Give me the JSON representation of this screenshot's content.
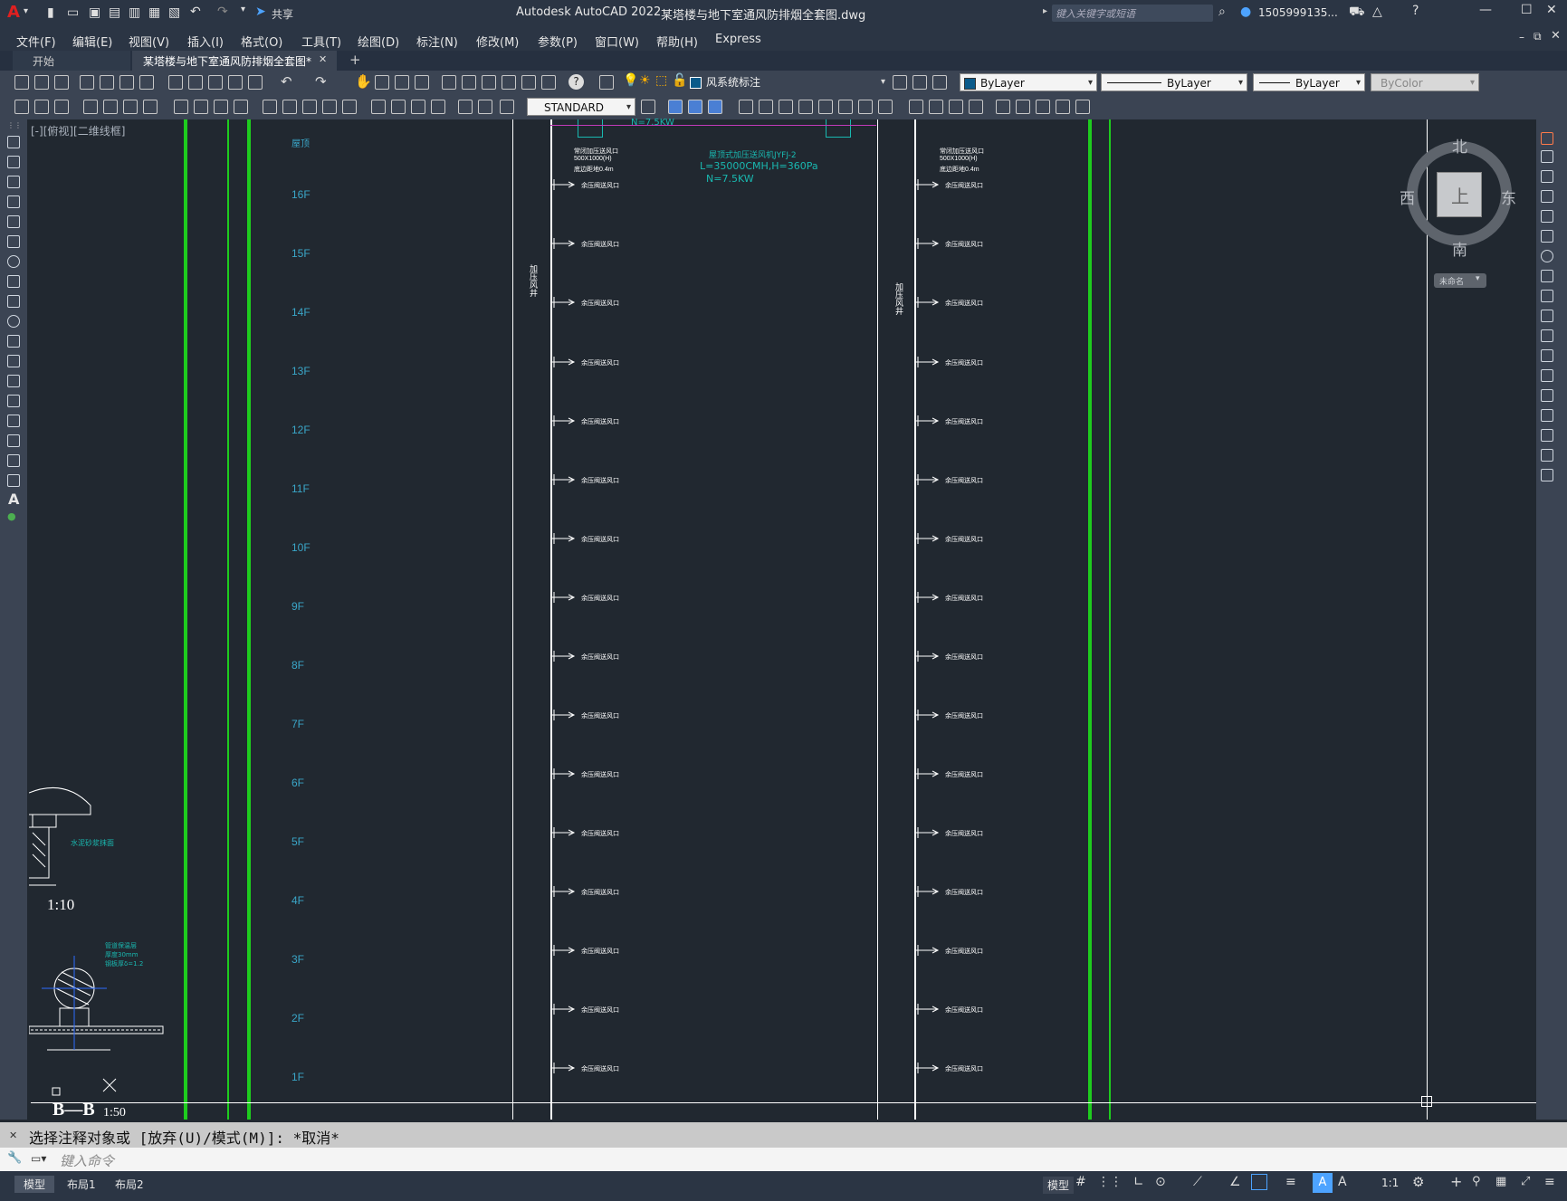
{
  "title": {
    "app_name": "Autodesk AutoCAD 2022",
    "file_name": "某塔楼与地下室通风防排烟全套图.dwg",
    "search_placeholder": "键入关键字或短语",
    "user": "1505999135...",
    "share_label": "共享"
  },
  "menu": [
    "文件(F)",
    "编辑(E)",
    "视图(V)",
    "插入(I)",
    "格式(O)",
    "工具(T)",
    "绘图(D)",
    "标注(N)",
    "修改(M)",
    "参数(P)",
    "窗口(W)",
    "帮助(H)",
    "Express"
  ],
  "tabs": {
    "start": "开始",
    "active": "某塔楼与地下室通风防排烟全套图*",
    "close": "✕",
    "add": "+"
  },
  "toolbar": {
    "layer_value": "风系统标注",
    "color_value": "ByLayer",
    "linetype_value": "ByLayer",
    "lineweight_value": "ByLayer",
    "plotstyle_value": "ByColor",
    "textstyle_value": "STANDARD"
  },
  "viewport": {
    "label": "[-][俯视][二维线框]",
    "north": "北",
    "south": "南",
    "east": "东",
    "west": "西",
    "top": "上",
    "wcs": "未命名"
  },
  "drawing": {
    "roof_label": "屋顶",
    "floors": [
      "16F",
      "15F",
      "14F",
      "13F",
      "12F",
      "11F",
      "10F",
      "9F",
      "8F",
      "7F",
      "6F",
      "5F",
      "4F",
      "3F",
      "2F",
      "1F"
    ],
    "shaft_label": "加压风井",
    "fan_note_1": "N=7.5KW",
    "fan_note_2": "屋顶式加压送风机JYFJ-2",
    "fan_note_3": "L=35000CMH,H=360Pa",
    "fan_note_4": "N=7.5KW",
    "outlet_note_1": "常闭加压送风口",
    "outlet_note_2": "500X1000(H)",
    "outlet_note_3": "底边距地0.4m",
    "valve_note": "余压阀送风口",
    "detail_scale_1": "1:10",
    "detail_scale_2": "1:50",
    "section_label": "B—B",
    "detail_note_1": "水泥砂浆抹面",
    "detail_note_2": "管道保温层",
    "detail_note_3": "厚度30mm",
    "detail_note_4": "钢板厚δ=1.2"
  },
  "command": {
    "history": "选择注释对象或 [放弃(U)/模式(M)]: *取消*",
    "placeholder": "键入命令"
  },
  "status": {
    "model_tab": "模型",
    "layout1": "布局1",
    "layout2": "布局2",
    "model_label": "模型",
    "scale": "1:1"
  },
  "colors": {
    "green_line": "#1ecc1e",
    "floor_text": "#3aa6c8",
    "canvas": "#212830"
  }
}
